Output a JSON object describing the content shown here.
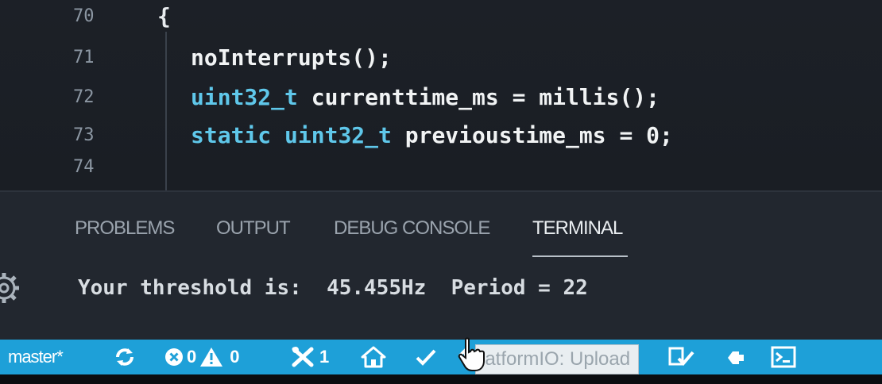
{
  "editor": {
    "lines": [
      {
        "num": "70",
        "brace": "{"
      },
      {
        "num": "71",
        "tokens": [
          {
            "t": "plain",
            "v": "noInterrupts();"
          }
        ]
      },
      {
        "num": "72",
        "tokens": [
          {
            "t": "type",
            "v": "uint32_t"
          },
          {
            "t": "plain",
            "v": " currenttime_ms = millis();"
          }
        ]
      },
      {
        "num": "73",
        "tokens": [
          {
            "t": "kw",
            "v": "static"
          },
          {
            "t": "plain",
            "v": " "
          },
          {
            "t": "type",
            "v": "uint32_t"
          },
          {
            "t": "plain",
            "v": " previoustime_ms = 0;"
          }
        ]
      },
      {
        "num": "74",
        "tokens": []
      }
    ]
  },
  "panel": {
    "tabs": [
      {
        "label": "PROBLEMS",
        "active": false
      },
      {
        "label": "OUTPUT",
        "active": false
      },
      {
        "label": "DEBUG CONSOLE",
        "active": false
      },
      {
        "label": "TERMINAL",
        "active": true
      }
    ],
    "terminal_output": "Your threshold is:  45.455Hz  Period = 22"
  },
  "statusbar": {
    "branch": "master*",
    "errors": "0",
    "warnings": "0",
    "tasks": "1",
    "tooltip": "PlatformIO: Upload",
    "tooltip_visible": "latformIO: Upload",
    "icons": [
      "sync-icon",
      "error-icon",
      "warning-icon",
      "tools-icon",
      "home-icon",
      "check-icon",
      "upload-icon",
      "clean-icon",
      "serial-icon",
      "terminal-icon"
    ]
  },
  "colors": {
    "statusbar_bg": "#1ea0d8",
    "panel_bg": "#22272f",
    "editor_bg": "#1a1e24",
    "type_token": "#5fc7ea"
  }
}
